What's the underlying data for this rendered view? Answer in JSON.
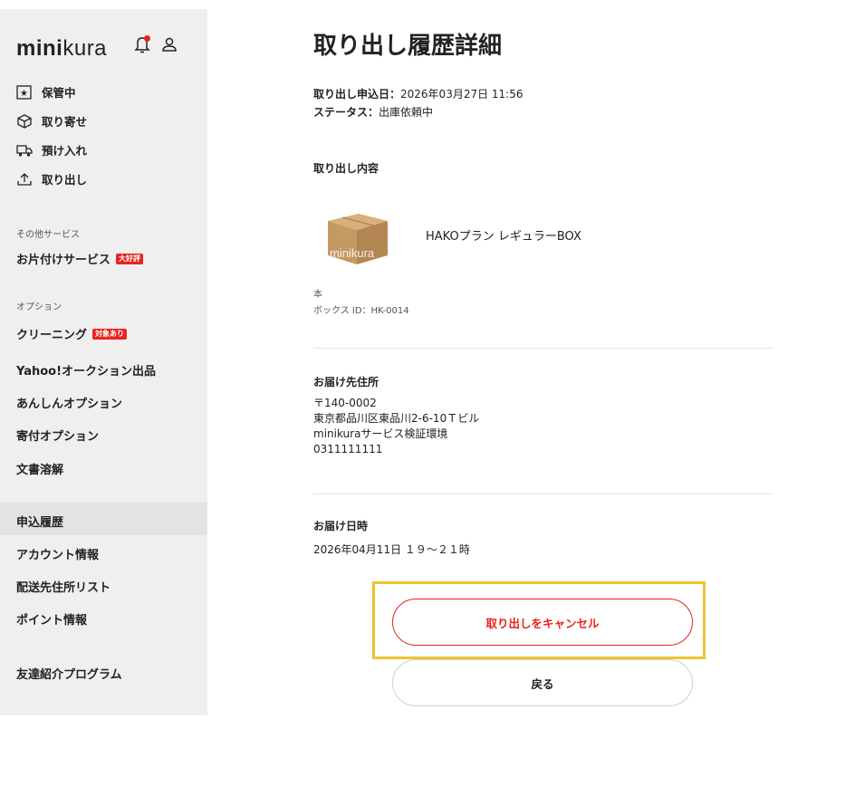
{
  "sidebar": {
    "brand_bold": "mini",
    "brand_light": "kura",
    "items": [
      {
        "label": "保管中",
        "icon": "star-box-icon"
      },
      {
        "label": "取り寄せ",
        "icon": "package-icon"
      },
      {
        "label": "預け入れ",
        "icon": "truck-icon"
      },
      {
        "label": "取り出し",
        "icon": "upload-icon"
      }
    ],
    "other_services_label": "その他サービス",
    "cleanup_label": "お片付けサービス",
    "cleanup_badge": "大好評",
    "options_label": "オプション",
    "cleaning_label": "クリーニング",
    "cleaning_badge": "対象あり",
    "yahoo_label": "Yahoo!オークション出品",
    "anshin_label": "あんしんオプション",
    "kifu_label": "寄付オプション",
    "bunsho_label": "文書溶解",
    "history_label": "申込履歴",
    "account_label": "アカウント情報",
    "address_list_label": "配送先住所リスト",
    "points_label": "ポイント情報",
    "friend_label": "友達紹介プログラム"
  },
  "main": {
    "title": "取り出し履歴詳細",
    "applied_label": "取り出し申込日：",
    "applied_value": "2026年03月27日 11:56",
    "status_label": "ステータス：",
    "status_value": "出庫依頼中",
    "content_title": "取り出し内容",
    "item_name": "HAKOプラン レギュラーBOX",
    "item_img_text": "minikura",
    "unit": "本",
    "box_id": "ボックス ID：HK-0014",
    "addr_title": "お届け先住所",
    "postal": "〒140-0002",
    "address": "東京都品川区東品川2-6-10Ｔビル",
    "recipient": "minikuraサービス検証環境",
    "phone": "0311111111",
    "date_title": "お届け日時",
    "date_value": "2026年04月11日 １９～２１時",
    "cancel_button": "取り出しをキャンセル",
    "back_button": "戻る"
  },
  "colors": {
    "accent": "#e8231e",
    "highlight": "#f0c330",
    "sidebar_bg": "#efefef"
  }
}
